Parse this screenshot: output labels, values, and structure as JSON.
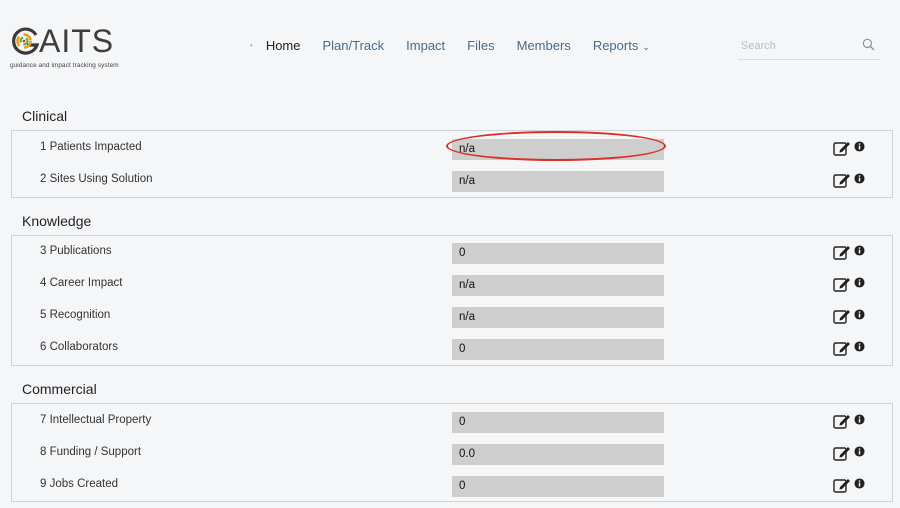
{
  "app": {
    "logo_text": "GAITS",
    "logo_rest": "AITS",
    "tagline": "guidance and impact tracking system"
  },
  "nav": {
    "items": [
      {
        "label": "Home",
        "active": true
      },
      {
        "label": "Plan/Track",
        "active": false
      },
      {
        "label": "Impact",
        "active": false
      },
      {
        "label": "Files",
        "active": false
      },
      {
        "label": "Members",
        "active": false
      },
      {
        "label": "Reports",
        "active": false,
        "dropdown": true
      }
    ]
  },
  "search": {
    "placeholder": "Search",
    "value": "",
    "icon": "search-icon"
  },
  "colors": {
    "highlight": "#d93025",
    "value_bg": "#cecece",
    "nav_link": "#4a6a87"
  },
  "sections": [
    {
      "title": "Clinical",
      "rows": [
        {
          "label": "1 Patients Impacted",
          "value": "n/a"
        },
        {
          "label": "2 Sites Using Solution",
          "value": "n/a"
        }
      ]
    },
    {
      "title": "Knowledge",
      "rows": [
        {
          "label": "3 Publications",
          "value": "0"
        },
        {
          "label": "4 Career Impact",
          "value": "n/a"
        },
        {
          "label": "5 Recognition",
          "value": "n/a"
        },
        {
          "label": "6 Collaborators",
          "value": "0"
        }
      ]
    },
    {
      "title": "Commercial",
      "rows": [
        {
          "label": "7 Intellectual Property",
          "value": "0"
        },
        {
          "label": "8 Funding / Support",
          "value": "0.0"
        },
        {
          "label": "9 Jobs Created",
          "value": "0"
        }
      ]
    }
  ]
}
